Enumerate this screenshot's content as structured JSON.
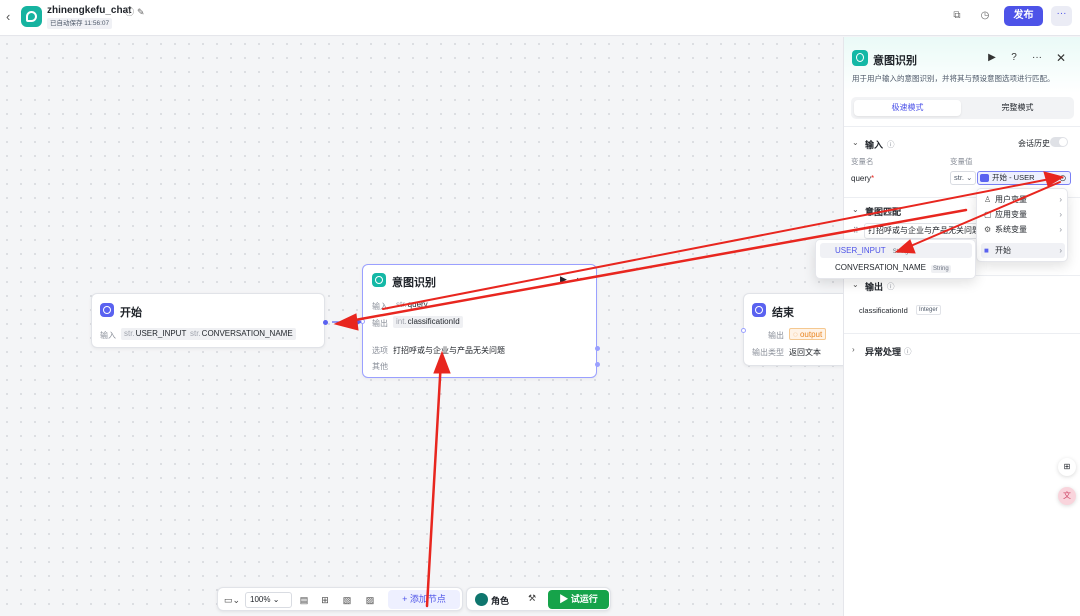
{
  "topbar": {
    "title": "zhinengkefu_chat",
    "save_status": "已自动保存 11:56:07",
    "publish_label": "发布",
    "more_label": "···"
  },
  "nodes": {
    "start": {
      "title": "开始",
      "input_label": "输入",
      "vars": [
        {
          "type": "str.",
          "name": "USER_INPUT"
        },
        {
          "type": "str.",
          "name": "CONVERSATION_NAME"
        }
      ]
    },
    "intent": {
      "title": "意图识别",
      "input_label": "输入",
      "input_type": "str.",
      "input_name": "query",
      "output_label": "输出",
      "output_type": "int.",
      "output_name": "classificationId",
      "option_label": "选项",
      "option_value": "打招呼或与企业与产品无关问题",
      "other_label": "其他"
    },
    "end": {
      "title": "结束",
      "output_label": "输出",
      "output_value": "output",
      "output_type_label": "输出类型",
      "output_type_value": "返回文本"
    }
  },
  "panel": {
    "title": "意图识别",
    "description": "用于用户输入的意图识别，并将其与预设意图选项进行匹配。",
    "tabs": [
      "极速模式",
      "完整模式"
    ],
    "active_tab": "极速模式",
    "input_section": {
      "title": "输入",
      "history_label": "会话历史",
      "col_name": "变量名",
      "col_value": "变量值",
      "param_name": "query",
      "param_type": "str.",
      "param_value": "开始 - USER"
    },
    "intent_section": {
      "title": "意图匹配",
      "option_value": "打招呼或与企业与产品无关问题"
    },
    "output_section": {
      "title": "输出",
      "var_name": "classificationId",
      "var_type": "Integer"
    },
    "exception_section": {
      "title": "异常处理"
    }
  },
  "var_menu": {
    "items": [
      {
        "icon": "user-icon",
        "label": "用户变量"
      },
      {
        "icon": "app-icon",
        "label": "应用变量"
      },
      {
        "icon": "gear-icon",
        "label": "系统变量"
      },
      {
        "icon": "start-icon",
        "label": "开始"
      }
    ],
    "active": "开始"
  },
  "var_submenu": {
    "items": [
      {
        "name": "USER_INPUT",
        "type": "String"
      },
      {
        "name": "CONVERSATION_NAME",
        "type": "String"
      }
    ],
    "active": "USER_INPUT"
  },
  "bottom_toolbar": {
    "zoom": "100%",
    "add_node_label": "添加节点",
    "role_label": "角色",
    "run_label": "试运行"
  },
  "colors": {
    "accent": "#4d53e8",
    "teal": "#14b8a6",
    "run_green": "#16a34a",
    "annotation_red": "#e8261f"
  }
}
